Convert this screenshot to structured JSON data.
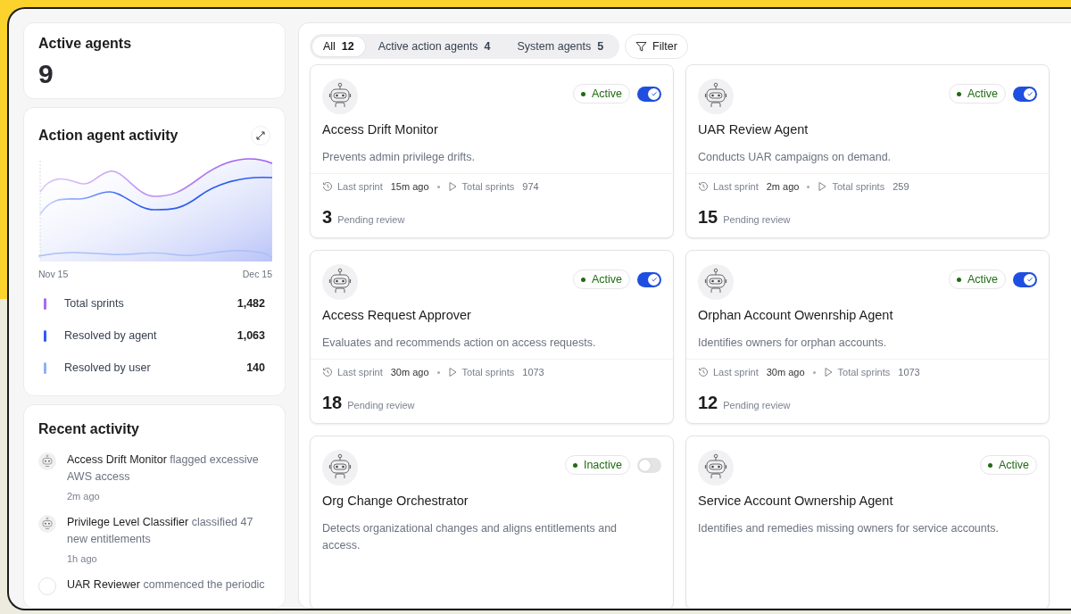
{
  "summary": {
    "title": "Active agents",
    "value": "9"
  },
  "activity": {
    "title": "Action agent activity",
    "x_labels": [
      "Nov 15",
      "Dec 15"
    ],
    "legend": [
      {
        "label": "Total sprints",
        "value": "1,482",
        "color": "#a56cf0"
      },
      {
        "label": "Resolved by agent",
        "value": "1,063",
        "color": "#2d5cf0"
      },
      {
        "label": "Resolved by user",
        "value": "140",
        "color": "#8fb0f5"
      }
    ]
  },
  "recent": {
    "title": "Recent activity",
    "items": [
      {
        "kind": "robot",
        "agent": "Access Drift Monitor",
        "action": "flagged excessive AWS access",
        "time": "2m ago"
      },
      {
        "kind": "robot",
        "agent": "Privilege Level Classifier",
        "action": "classified 47 new entitlements",
        "time": "1h ago"
      },
      {
        "kind": "empty",
        "agent": "UAR Reviewer",
        "action": "commenced the periodic"
      }
    ]
  },
  "tabs": [
    {
      "label": "All",
      "count": "12",
      "selected": true
    },
    {
      "label": "Active action agents",
      "count": "4",
      "selected": false
    },
    {
      "label": "System agents",
      "count": "5",
      "selected": false
    }
  ],
  "filter": "Filter",
  "agents": [
    {
      "name": "Access Drift Monitor",
      "status": "Active",
      "enabled": true,
      "description": "Prevents admin privilege drifts.",
      "last_sprint_label": "Last sprint",
      "last_sprint": "15m ago",
      "total_label": "Total sprints",
      "total": "974",
      "pending": "3",
      "pending_label": "Pending review"
    },
    {
      "name": "UAR Review Agent",
      "status": "Active",
      "enabled": true,
      "description": "Conducts UAR campaigns on demand.",
      "last_sprint_label": "Last sprint",
      "last_sprint": "2m ago",
      "total_label": "Total sprints",
      "total": "259",
      "pending": "15",
      "pending_label": "Pending review"
    },
    {
      "name": "Access Request Approver",
      "status": "Active",
      "enabled": true,
      "description": "Evaluates and recommends action on access requests.",
      "last_sprint_label": "Last sprint",
      "last_sprint": "30m ago",
      "total_label": "Total sprints",
      "total": "1073",
      "pending": "18",
      "pending_label": "Pending review"
    },
    {
      "name": "Orphan Account Owenrship Agent",
      "status": "Active",
      "enabled": true,
      "description": "Identifies owners for orphan accounts.",
      "last_sprint_label": "Last sprint",
      "last_sprint": "30m ago",
      "total_label": "Total sprints",
      "total": "1073",
      "pending": "12",
      "pending_label": "Pending review"
    },
    {
      "name": "Org Change Orchestrator",
      "status": "Inactive",
      "enabled": false,
      "description": "Detects organizational changes and aligns entitlements and access."
    },
    {
      "name": "Service Account Ownership Agent",
      "status": "Active",
      "description": "Identifies and remedies missing owners for service accounts."
    }
  ]
}
